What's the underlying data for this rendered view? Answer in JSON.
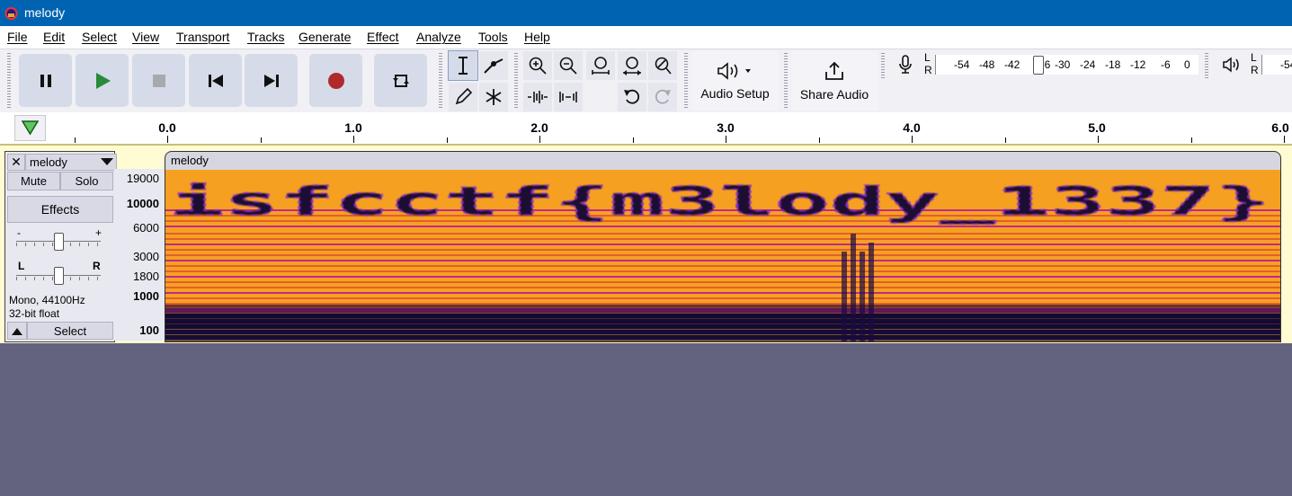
{
  "window": {
    "title": "melody"
  },
  "menu": [
    "File",
    "Edit",
    "Select",
    "View",
    "Transport",
    "Tracks",
    "Generate",
    "Effect",
    "Analyze",
    "Tools",
    "Help"
  ],
  "toolbar": {
    "audio_setup_label": "Audio Setup",
    "share_audio_label": "Share Audio",
    "meter_record_scale": [
      "-54",
      "-48",
      "-42",
      "-36",
      "-30",
      "-24",
      "-18",
      "-12",
      "-6",
      "0"
    ],
    "meter_play_scale": [
      "-54"
    ],
    "meter_lr": [
      "L",
      "R"
    ]
  },
  "timeline": {
    "labels": [
      "0.0",
      "1.0",
      "2.0",
      "3.0",
      "4.0",
      "5.0",
      "6.0"
    ]
  },
  "track": {
    "name": "melody",
    "clip_name": "melody",
    "mute_label": "Mute",
    "solo_label": "Solo",
    "effects_label": "Effects",
    "gain_minus": "-",
    "gain_plus": "+",
    "pan_left": "L",
    "pan_right": "R",
    "info_rate": "Mono, 44100Hz",
    "info_format": "32-bit float",
    "select_label": "Select",
    "freq_labels": [
      "19000",
      "10000",
      "6000",
      "3000",
      "1800",
      "1000",
      "100"
    ]
  },
  "spectrogram": {
    "hidden_text": "isfcctf{m3lody_1337}"
  },
  "colors": {
    "titlebar": "#0063b1",
    "spectrogram_bg": "#f6a022",
    "workspace": "#63637f"
  }
}
